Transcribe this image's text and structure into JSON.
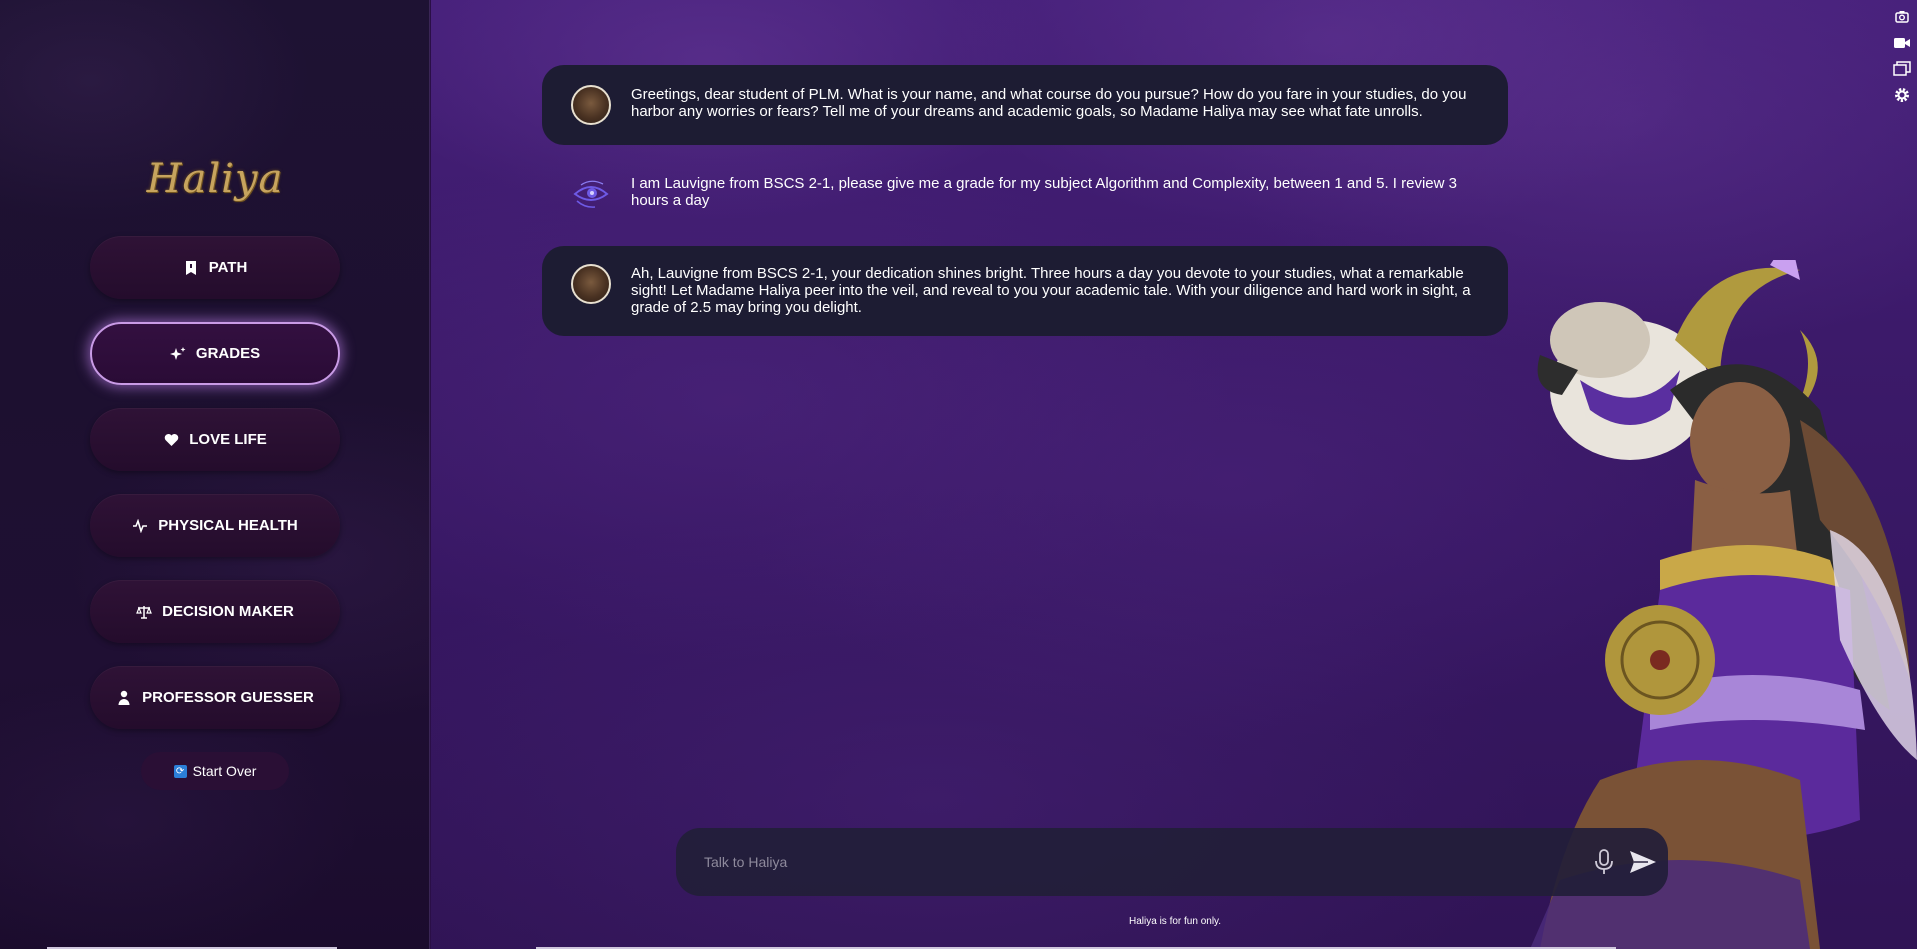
{
  "app": {
    "logo_text": "Haliya"
  },
  "sidebar": {
    "items": [
      {
        "label": "PATH",
        "icon": "book-icon"
      },
      {
        "label": "GRADES",
        "icon": "sparkles-icon",
        "active": true
      },
      {
        "label": "LOVE LIFE",
        "icon": "heart-icon"
      },
      {
        "label": "PHYSICAL HEALTH",
        "icon": "pulse-icon"
      },
      {
        "label": "DECISION MAKER",
        "icon": "scale-icon"
      },
      {
        "label": "PROFESSOR GUESSER",
        "icon": "person-icon"
      }
    ],
    "start_over_label": "Start Over"
  },
  "chat": {
    "messages": [
      {
        "role": "bot",
        "text": "Greetings, dear student of PLM. What is your name, and what course do you pursue? How do you fare in your studies, do you harbor any worries or fears? Tell me of your dreams and academic goals, so Madame Haliya may see what fate unrolls."
      },
      {
        "role": "user",
        "text": "I am Lauvigne from BSCS 2-1, please give me a grade for my subject Algorithm and Complexity, between 1 and 5. I review 3 hours a day"
      },
      {
        "role": "bot",
        "text": "Ah, Lauvigne from BSCS 2-1, your dedication shines bright. Three hours a day you devote to your studies, what a remarkable sight! Let Madame Haliya peer into the veil, and reveal to you your academic tale. With your diligence and hard work in sight, a grade of 2.5 may bring you delight."
      }
    ]
  },
  "input": {
    "placeholder": "Talk to Haliya",
    "value": ""
  },
  "footer": {
    "note": "Haliya is for fun only."
  },
  "toolbar": {
    "tools": [
      "screenshot-icon",
      "camera-icon",
      "windows-icon",
      "gear-icon"
    ]
  },
  "colors": {
    "accent_glow": "#c99be6",
    "bubble_bg": "#1d1c33",
    "user_icon": "#6e5ae6",
    "logo_gold": "#c7a45e"
  }
}
